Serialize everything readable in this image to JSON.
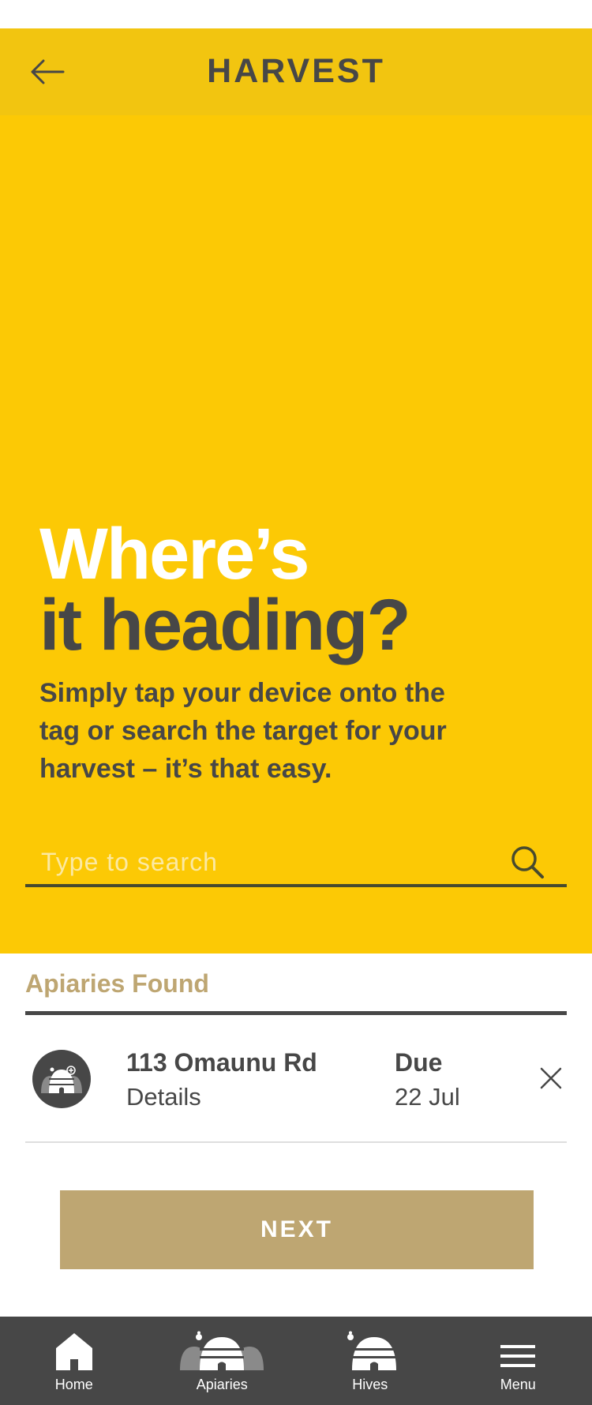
{
  "header": {
    "title": "HARVEST",
    "back_icon": "arrow-left-icon"
  },
  "hero": {
    "headline_line1": "Where’s",
    "headline_line2": "it heading?",
    "subtext": "Simply tap your device onto the tag or search the target for your harvest – it’s that easy.",
    "search_placeholder": "Type to search",
    "search_value": ""
  },
  "results": {
    "section_title": "Apiaries Found",
    "items": [
      {
        "name": "113 Omaunu Rd",
        "details": "Details",
        "due_label": "Due",
        "due_date": "22 Jul"
      }
    ]
  },
  "next_label": "NEXT",
  "nav": {
    "items": [
      {
        "label": "Home",
        "icon": "home-icon"
      },
      {
        "label": "Apiaries",
        "icon": "apiaries-icon"
      },
      {
        "label": "Hives",
        "icon": "hive-icon"
      },
      {
        "label": "Menu",
        "icon": "menu-icon"
      }
    ]
  },
  "colors": {
    "header": "#f2c510",
    "hero": "#fcc905",
    "accent_gold": "#bea672",
    "dark": "#474747",
    "white": "#ffffff"
  }
}
